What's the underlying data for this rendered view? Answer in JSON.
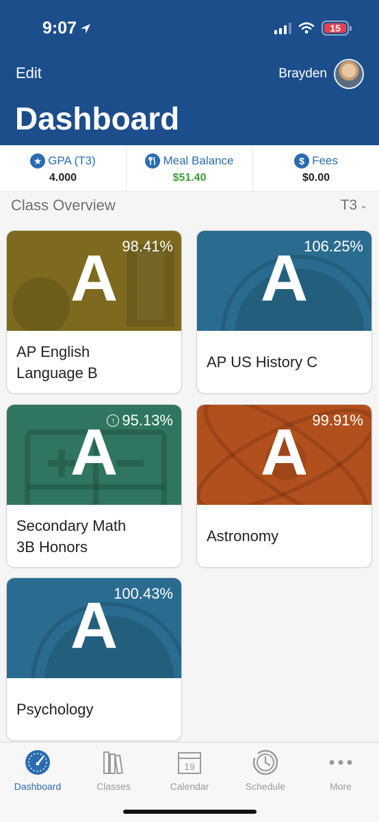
{
  "status_bar": {
    "time": "9:07",
    "battery": "15"
  },
  "header": {
    "edit_label": "Edit",
    "user_name": "Brayden",
    "title": "Dashboard"
  },
  "stats": [
    {
      "label": "GPA (T3)",
      "value": "4.000",
      "icon": "star-icon"
    },
    {
      "label": "Meal Balance",
      "value": "$51.40",
      "icon": "utensils-icon"
    },
    {
      "label": "Fees",
      "value": "$0.00",
      "icon": "dollar-icon"
    }
  ],
  "overview": {
    "title": "Class Overview",
    "term": "T3"
  },
  "classes": [
    {
      "name": "AP English Language B",
      "grade": "A",
      "percent": "98.41%",
      "color": "#7d6a1f",
      "trend": null
    },
    {
      "name": "AP US History C",
      "grade": "A",
      "percent": "106.25%",
      "color": "#2a6c8f",
      "trend": null
    },
    {
      "name": "Secondary Math 3B Honors",
      "grade": "A",
      "percent": "95.13%",
      "color": "#2f7561",
      "trend": "up"
    },
    {
      "name": "Astronomy",
      "grade": "A",
      "percent": "99.91%",
      "color": "#b2501d",
      "trend": null
    },
    {
      "name": "Psychology",
      "grade": "A",
      "percent": "100.43%",
      "color": "#2a6c8f",
      "trend": null
    }
  ],
  "tabs": [
    {
      "label": "Dashboard",
      "icon": "speedometer-icon",
      "active": true
    },
    {
      "label": "Classes",
      "icon": "books-icon",
      "active": false
    },
    {
      "label": "Calendar",
      "icon": "calendar-icon",
      "active": false,
      "day": "19"
    },
    {
      "label": "Schedule",
      "icon": "clock-history-icon",
      "active": false
    },
    {
      "label": "More",
      "icon": "more-dots-icon",
      "active": false
    }
  ]
}
